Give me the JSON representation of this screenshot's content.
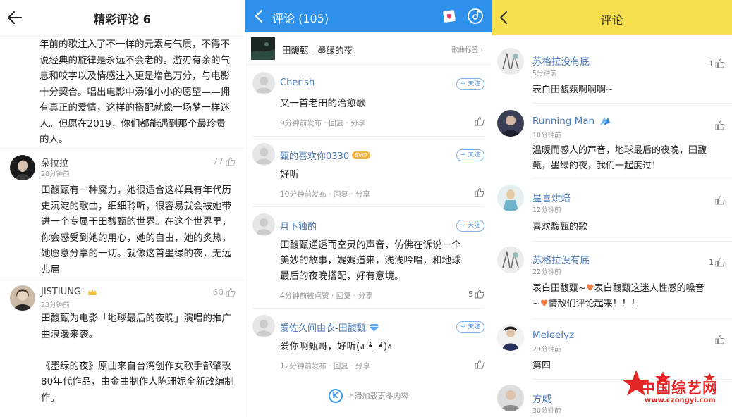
{
  "panel1": {
    "title": "精彩评论 6",
    "lead_lines": [
      "年前的歌注入了不一样的元素与气质，不得不",
      "说经典的旋律是永远不会老的。游刃有余的气",
      "息和咬字以及情感注入更是增色万分，与电影",
      "十分契合。唱出电影中汤唯小小的愿望——拥",
      "有真正的爱情，这样的搭配就像一场梦一样迷",
      "人。但愿在2019，你们都能遇到那个最珍贵",
      "的人。"
    ],
    "comments": [
      {
        "name": "朵拉拉",
        "time": "20分钟前",
        "likes": "77",
        "lines": [
          "田馥甄有一种魔力，她很适合这样具有年代历",
          "史沉淀的歌曲，细细聆听，很容易就会被她带",
          "进一个专属于田馥甄的世界。在这个世界里，",
          "你会感受到她的用心，她的自由，她的炙热，",
          "她愿意分享的一切。就像这首墨绿的夜，无远",
          "弗届"
        ]
      },
      {
        "name": "JISTIUNG-",
        "time": "23分钟前",
        "likes": "60",
        "lines": [
          "田馥甄为电影「地球最后的夜晚」演唱的推广",
          "曲浪漫来袭。",
          "",
          "《墨绿的夜》原曲来自台湾创作女歌手部肇玫",
          "80年代作品，由金曲制作人陈珊妮全新改编制",
          "作。"
        ]
      }
    ]
  },
  "panel2": {
    "title": "评论 (105)",
    "song_name": "田馥甄 - 墨绿的夜",
    "song_tag": "歌曲标签",
    "follow_label": "+ 关注",
    "reply_label": "回复",
    "share_label": "分享",
    "load_more": "上滑加载更多内容",
    "load_more_icon": "K",
    "comments": [
      {
        "name": "Cherish",
        "text": "又一首老田的治愈歌",
        "meta_time": "9分钟前发布",
        "likes": ""
      },
      {
        "name": "甄的喜欢你0330",
        "badge": "SVIP",
        "text": "好听",
        "meta_time": "10分钟前发布",
        "likes": ""
      },
      {
        "name": "月下独酌",
        "text_lines": [
          "田馥甄通透而空灵的声音，仿佛在诉说一个",
          "美妙的故事，娓娓道来，浅浅吟唱，和地球",
          "最后的夜晚搭配，好有意境。"
        ],
        "meta_time": "4分钟前被点赞",
        "likes": "5"
      },
      {
        "name": "爱佐久间由衣-田馥甄",
        "text": "爱你啊甄哥，好听(ง •̀_•́)ง",
        "meta_time": "12分钟前发布",
        "likes": ""
      }
    ]
  },
  "panel3": {
    "title": "评论",
    "comments": [
      {
        "name": "苏格拉没有底",
        "time": "5分钟前",
        "likes": "1",
        "text": "表白田馥甄啊啊啊~"
      },
      {
        "name": "Running Man",
        "time": "10分钟前",
        "likes": "",
        "lines": [
          "温暖而感人的声音，地球最后的夜晚，田馥",
          "甄，墨绿的夜，我们一起度过！"
        ]
      },
      {
        "name": "星喜烘焙",
        "time": "12分钟前",
        "likes": "",
        "text": "喜欢馥甄的歌"
      },
      {
        "name": "苏格拉没有底",
        "time": "22分钟前",
        "likes": "1",
        "line1a": "表白田馥甄~",
        "line1b": "表白馥甄这迷人性感的嗓音",
        "line2a": "~",
        "line2b": "情敌们评论起来！！！"
      },
      {
        "name": "Meleelyz",
        "time": "23分钟前",
        "likes": "",
        "text": "第四"
      },
      {
        "name": "方威",
        "time": "30分钟前",
        "likes": ""
      }
    ]
  },
  "watermark": {
    "text": "中国综艺网",
    "url": "www.czongyi.com"
  }
}
